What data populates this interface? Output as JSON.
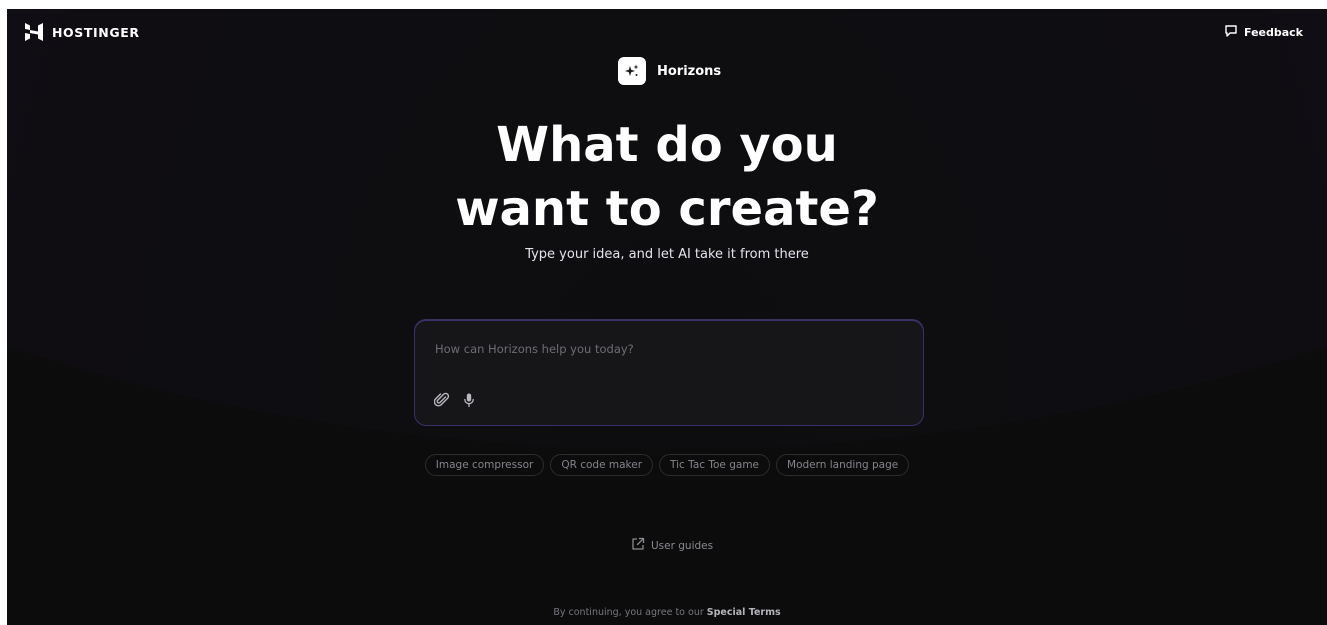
{
  "topbar": {
    "logo_text": "HOSTINGER",
    "feedback_label": "Feedback"
  },
  "brand": {
    "name": "Horizons"
  },
  "hero": {
    "title_line1": "What do you",
    "title_line2": "want to create?",
    "subtitle": "Type your idea, and let AI take it from there"
  },
  "prompt": {
    "placeholder": "How can Horizons help you today?",
    "value": ""
  },
  "suggestions": [
    {
      "label": "Image compressor"
    },
    {
      "label": "QR code maker"
    },
    {
      "label": "Tic Tac Toe game"
    },
    {
      "label": "Modern landing page"
    }
  ],
  "links": {
    "user_guides": "User guides"
  },
  "footer": {
    "prefix": "By continuing, you agree to our",
    "link": "Special Terms"
  },
  "colors": {
    "accent_purple": "#6237d6",
    "background": "#0c0c0d",
    "input_border": "#3b2f6b"
  },
  "icons": {
    "logo": "hostinger-h-icon",
    "feedback": "chat-bubble-icon",
    "brand": "sparkles-icon",
    "attach": "paperclip-icon",
    "mic": "microphone-icon",
    "guides": "external-link-icon"
  }
}
